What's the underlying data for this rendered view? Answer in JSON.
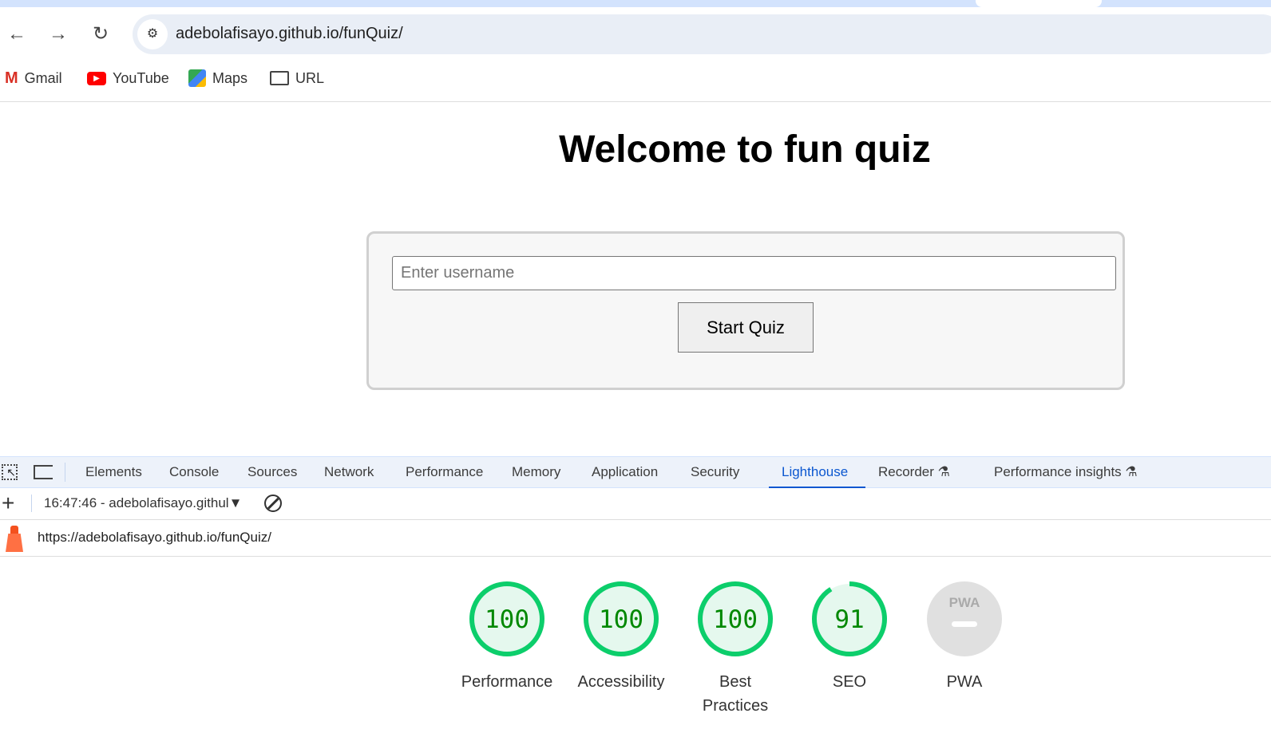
{
  "browser": {
    "url": "adebolafisayo.github.io/funQuiz/",
    "bookmarks": [
      {
        "label": "Gmail",
        "icon": "gmail-icon"
      },
      {
        "label": "YouTube",
        "icon": "youtube-icon"
      },
      {
        "label": "Maps",
        "icon": "maps-icon"
      },
      {
        "label": "URL",
        "icon": "folder-icon"
      }
    ]
  },
  "page": {
    "title": "Welcome to fun quiz",
    "username_placeholder": "Enter username",
    "username_value": "",
    "start_label": "Start Quiz"
  },
  "devtools": {
    "tabs": [
      "Elements",
      "Console",
      "Sources",
      "Network",
      "Performance",
      "Memory",
      "Application",
      "Security",
      "Lighthouse",
      "Recorder",
      "Performance insights"
    ],
    "active_tab": "Lighthouse",
    "report_select": "16:47:46 - adebolafisayo.githul",
    "report_url": "https://adebolafisayo.github.io/funQuiz/",
    "scores": [
      {
        "label": "Performance",
        "value": "100"
      },
      {
        "label": "Accessibility",
        "value": "100"
      },
      {
        "label": "Best Practices",
        "value": "100"
      },
      {
        "label": "SEO",
        "value": "91"
      },
      {
        "label": "PWA",
        "value": "",
        "badge": "PWA"
      }
    ],
    "colors": {
      "pass": "#0cce6b",
      "pass_text": "#008800",
      "pass_bg": "#e5f8ee",
      "na": "#e0e0e0",
      "accent": "#0b57d0"
    }
  }
}
